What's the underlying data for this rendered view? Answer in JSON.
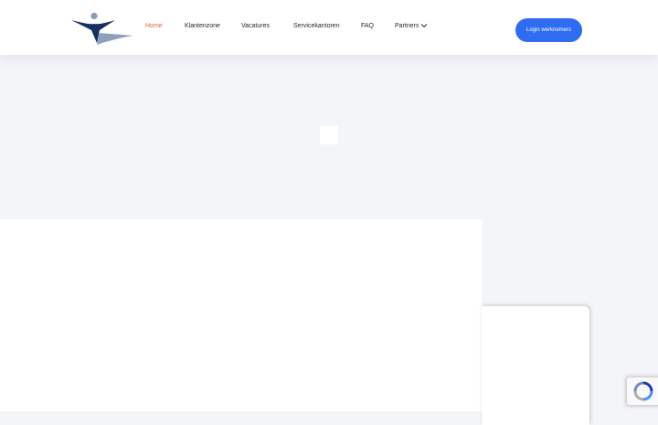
{
  "nav": {
    "items": [
      {
        "label": "Home",
        "active": true
      },
      {
        "label": "Klantenzone",
        "active": false
      },
      {
        "label": "Vacatures",
        "active": false
      },
      {
        "label": "Servicekantoren",
        "active": false
      },
      {
        "label": "FAQ",
        "active": false
      },
      {
        "label": "Partners",
        "active": false,
        "has_dropdown": true
      }
    ]
  },
  "login": {
    "label": "Login werknemers"
  },
  "icons": {
    "logo": "brand-logo",
    "dropdown": "chevron-down-icon",
    "recaptcha": "recaptcha-icon"
  },
  "colors": {
    "accent_active": "#e2673a",
    "button_blue": "#2e6cf2",
    "logo_navy": "#16305f",
    "background": "#f4f5f9"
  }
}
